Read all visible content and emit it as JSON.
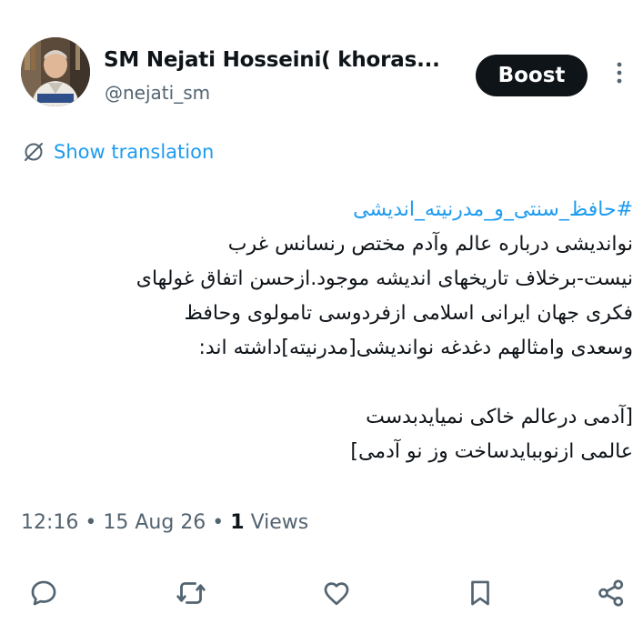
{
  "colors": {
    "text": "#0f1419",
    "secondary": "#536471",
    "link": "#1d9bf0",
    "button_bg": "#0f1419",
    "button_text": "#ffffff",
    "icon": "#536471"
  },
  "author": {
    "display_name": "SM Nejati Hosseini( khoras...",
    "handle": "@nejati_sm"
  },
  "header": {
    "boost_label": "Boost",
    "more_icon": "more-vertical-icon"
  },
  "translation": {
    "label": "Show translation",
    "icon": "translate-icon"
  },
  "post": {
    "hashtag": "#حافظ_سنتی_و_مدرنیته_اندیشی",
    "lines": [
      "نواندیشی درباره عالم وآدم مختص رنسانس غرب",
      "نیست-برخلاف تاریخهای اندیشه موجود.ازحسن اتفاق غولهای",
      "فکری جهان ایرانی اسلامی ازفردوسی تامولوی وحافظ",
      "وسعدی وامثالهم دغدغه نواندیشی[مدرنیته]داشته اند:",
      "",
      "[آدمی درعالم خاکی نمیایدبدست",
      "عالمی ازنوببایدساخت وز نو آدمی]"
    ]
  },
  "meta": {
    "time": "12:16",
    "sep1": " • ",
    "date": "15 Aug 26",
    "sep2": " • ",
    "views_count": "1",
    "views_label": " Views"
  },
  "actions": [
    {
      "name": "reply-icon"
    },
    {
      "name": "repost-icon"
    },
    {
      "name": "like-icon"
    },
    {
      "name": "bookmark-icon"
    },
    {
      "name": "share-icon"
    }
  ]
}
